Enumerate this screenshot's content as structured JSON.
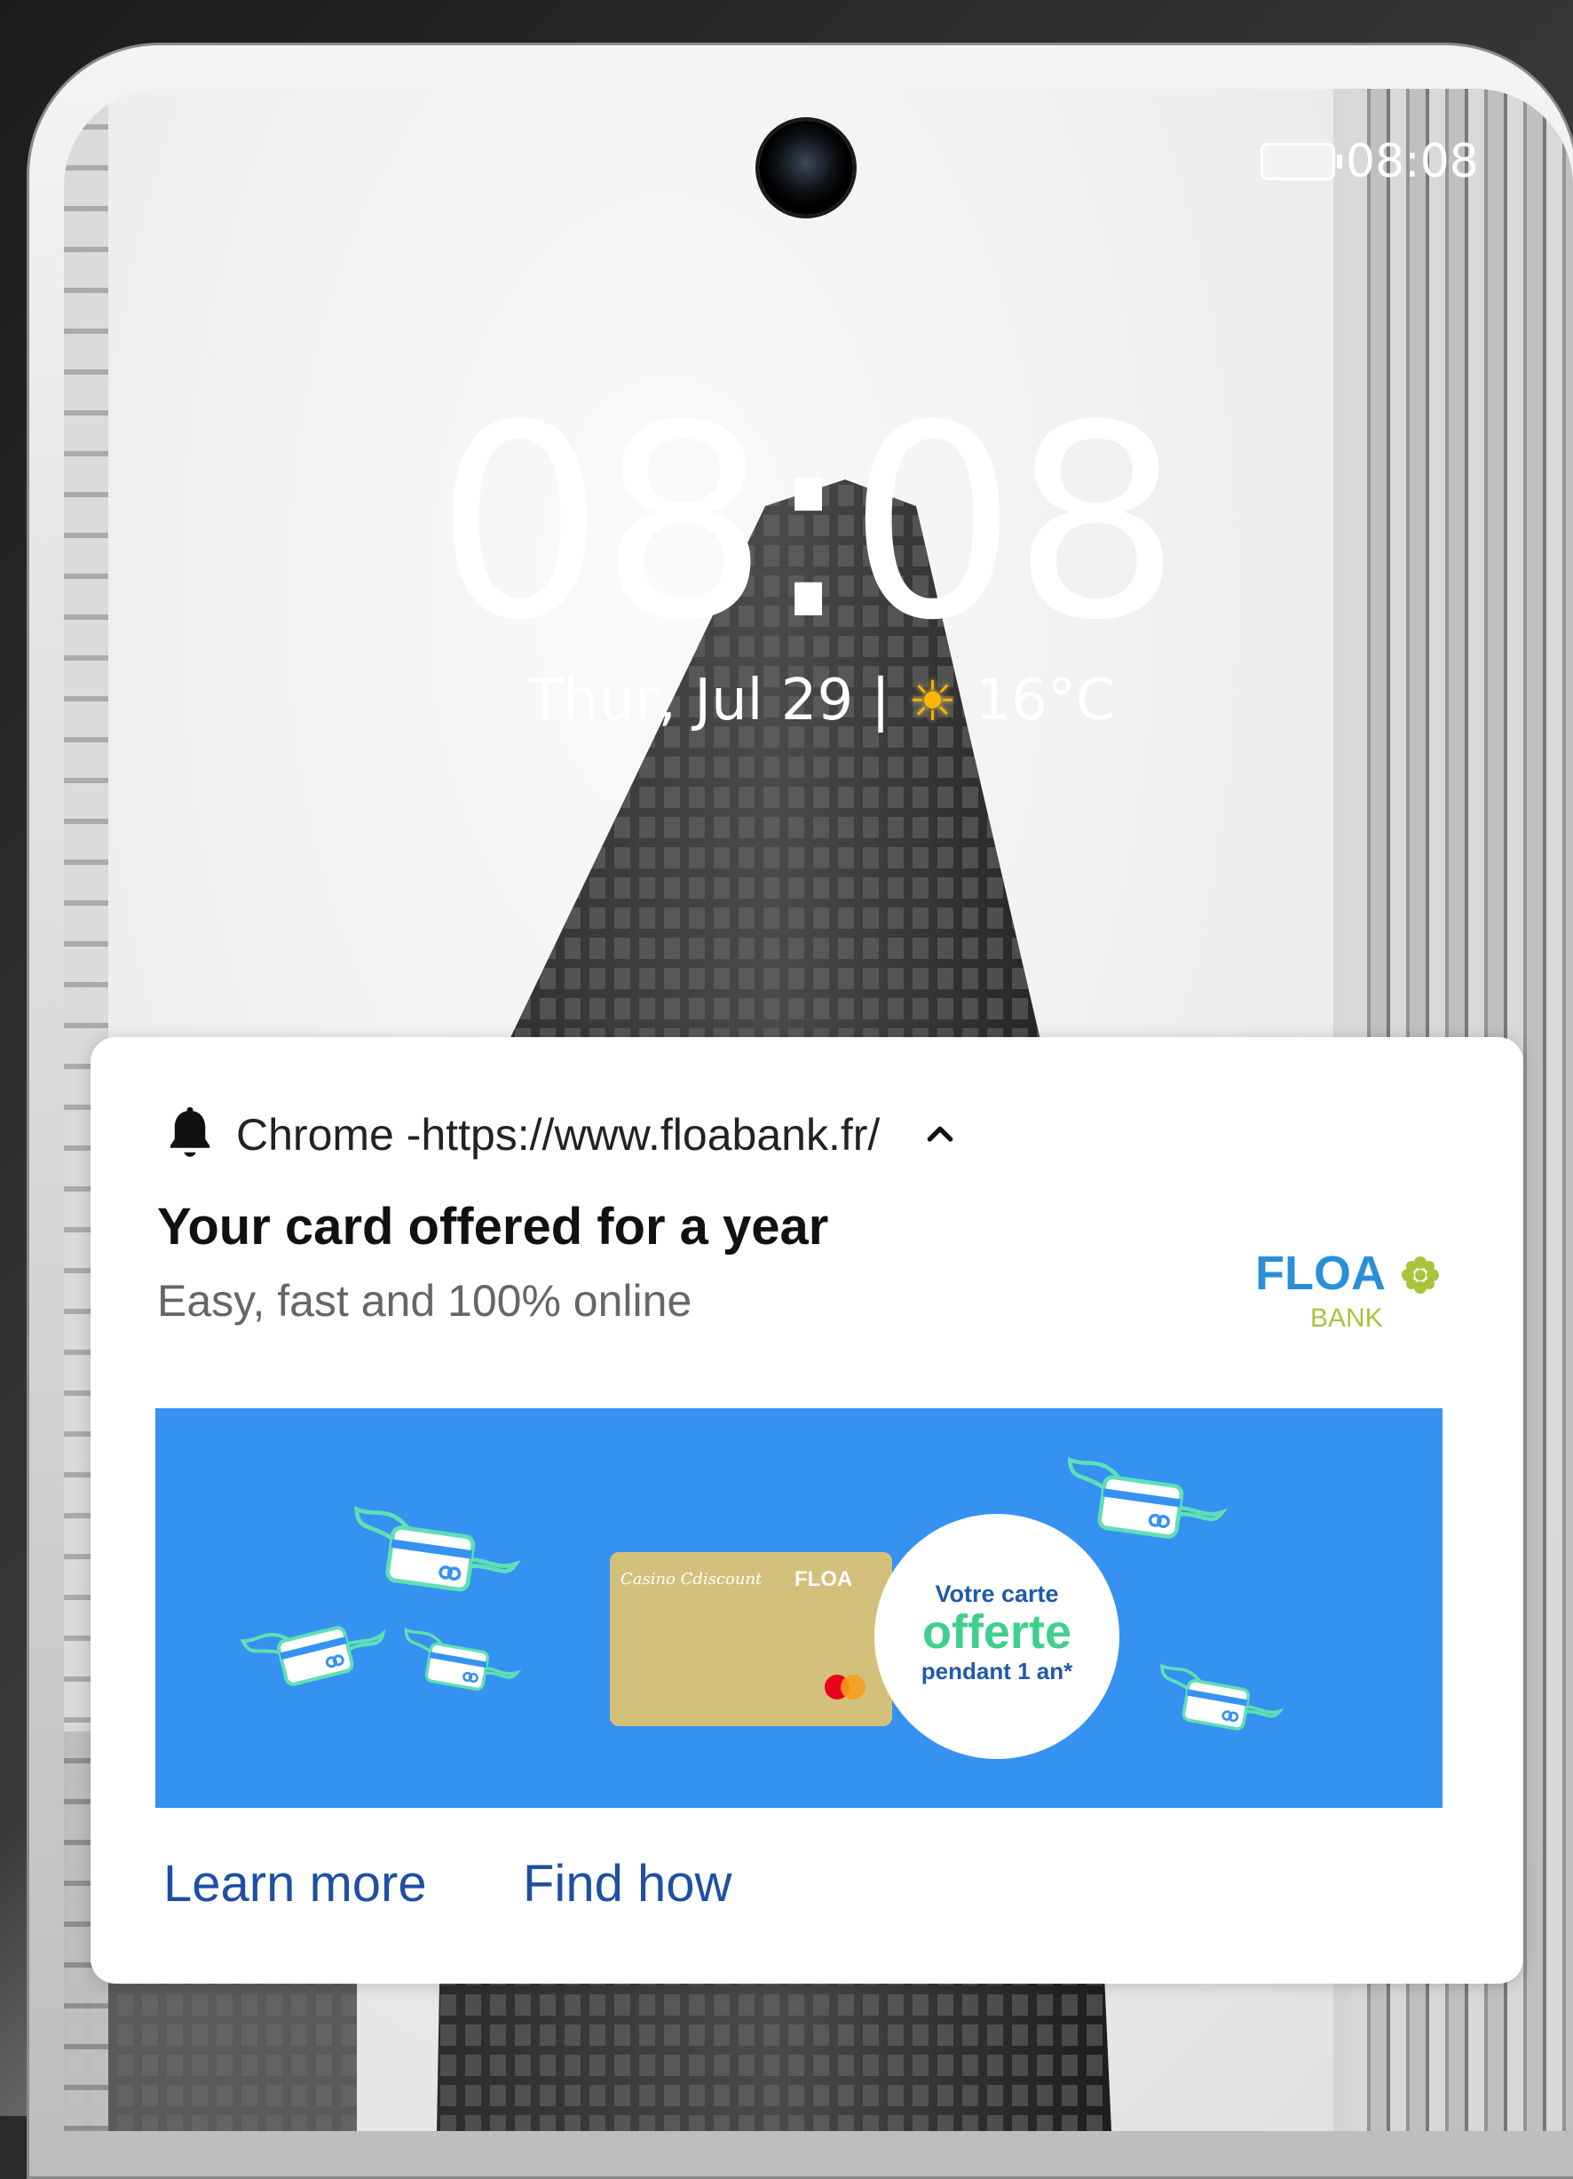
{
  "status_bar": {
    "time": "08:08",
    "battery_icon": "battery-icon"
  },
  "lockscreen": {
    "clock": "08:08",
    "date": "Thur, Jul 29",
    "separator": "|",
    "weather_icon": "sun-icon",
    "temperature": "16°C"
  },
  "notification": {
    "app_icon": "bell-icon",
    "source": "Chrome -https://www.floabank.fr/",
    "expand_icon": "chevron-up-icon",
    "title": "Your card offered for a year",
    "body": "Easy, fast and 100% online",
    "logo": {
      "brand": "FLOA",
      "sub": "BANK"
    },
    "banner": {
      "card_brand_left": "Casino Cdiscount",
      "card_brand_right": "FLOA",
      "badge_line1": "Votre carte",
      "badge_line2": "offerte",
      "badge_line3": "pendant 1 an*",
      "background_color": "#3592f1"
    },
    "actions": {
      "learn_more": "Learn more",
      "find_how": "Find how"
    }
  },
  "colors": {
    "action_text": "#1e4fa3",
    "floa_blue": "#2a8fd8",
    "floa_green": "#a9c43a"
  }
}
